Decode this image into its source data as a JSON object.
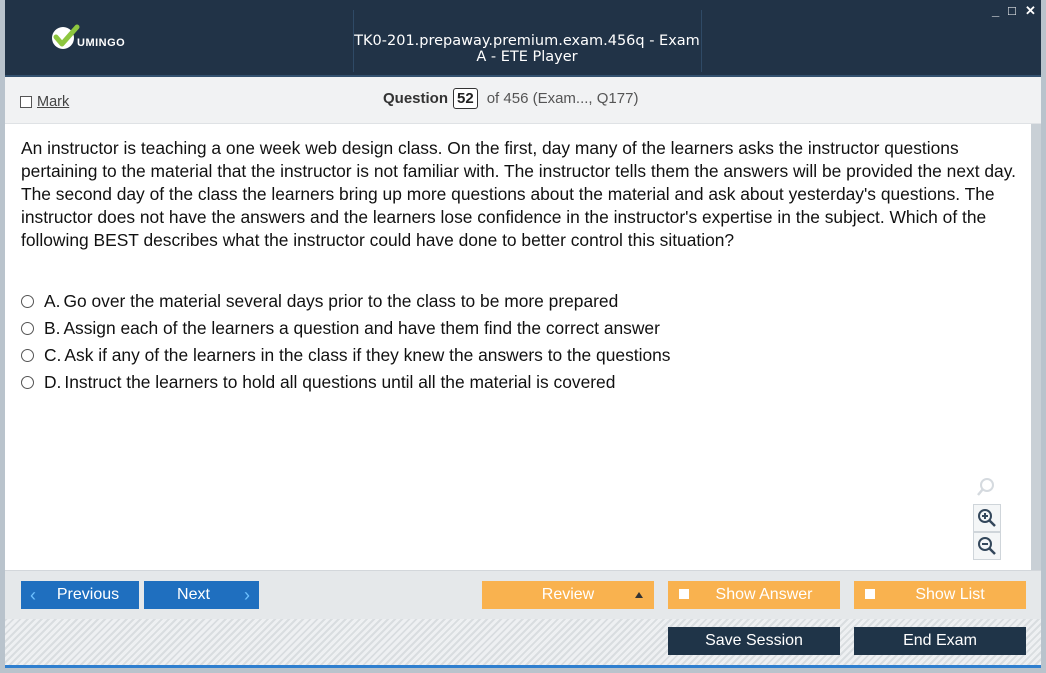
{
  "window": {
    "title": "TK0-201.prepaway.premium.exam.456q - Exam A - ETE Player",
    "controls": {
      "minimize": "_",
      "maximize": "□",
      "close": "✕"
    }
  },
  "logo": {
    "text": "UMINGO",
    "icon": "checkmark-logo-icon",
    "colors": {
      "check": "#8dc63f"
    }
  },
  "header": {
    "mark_label": "Mark",
    "mark_checked": false,
    "question_word": "Question",
    "question_number": "52",
    "question_of": "of 456 (Exam..., Q177)"
  },
  "question": {
    "text": "An instructor is teaching a one week web design class. On the first, day many of the learners asks the instructor questions pertaining to the material that the instructor is not familiar with. The instructor tells them the answers will be provided the next day. The second day of the class the learners bring up more questions about the material and ask about yesterday's questions. The instructor does not have the answers and the learners lose confidence in the instructor's expertise in the subject. Which of the following BEST describes what the instructor could have done to better control this situation?",
    "answers": [
      {
        "letter": "A.",
        "text": "Go over the material several days prior to the class to be more prepared",
        "selected": false
      },
      {
        "letter": "B.",
        "text": "Assign each of the learners a question and have them find the correct answer",
        "selected": false
      },
      {
        "letter": "C.",
        "text": "Ask if any of the learners in the class if they knew the answers to the questions",
        "selected": false
      },
      {
        "letter": "D.",
        "text": "Instruct the learners to hold all questions until all the material is covered",
        "selected": false
      }
    ]
  },
  "zoom": {
    "icons": [
      "search-icon",
      "zoom-in-icon",
      "zoom-out-icon"
    ]
  },
  "nav": {
    "previous_label": "Previous",
    "next_label": "Next",
    "review_label": "Review",
    "show_answer_label": "Show Answer",
    "show_list_label": "Show List",
    "save_session_label": "Save Session",
    "end_exam_label": "End Exam"
  },
  "colors": {
    "titlebar": "#213347",
    "nav_blue": "#1f6fbf",
    "orange": "#f9b24f",
    "dark_button": "#1f3448"
  }
}
